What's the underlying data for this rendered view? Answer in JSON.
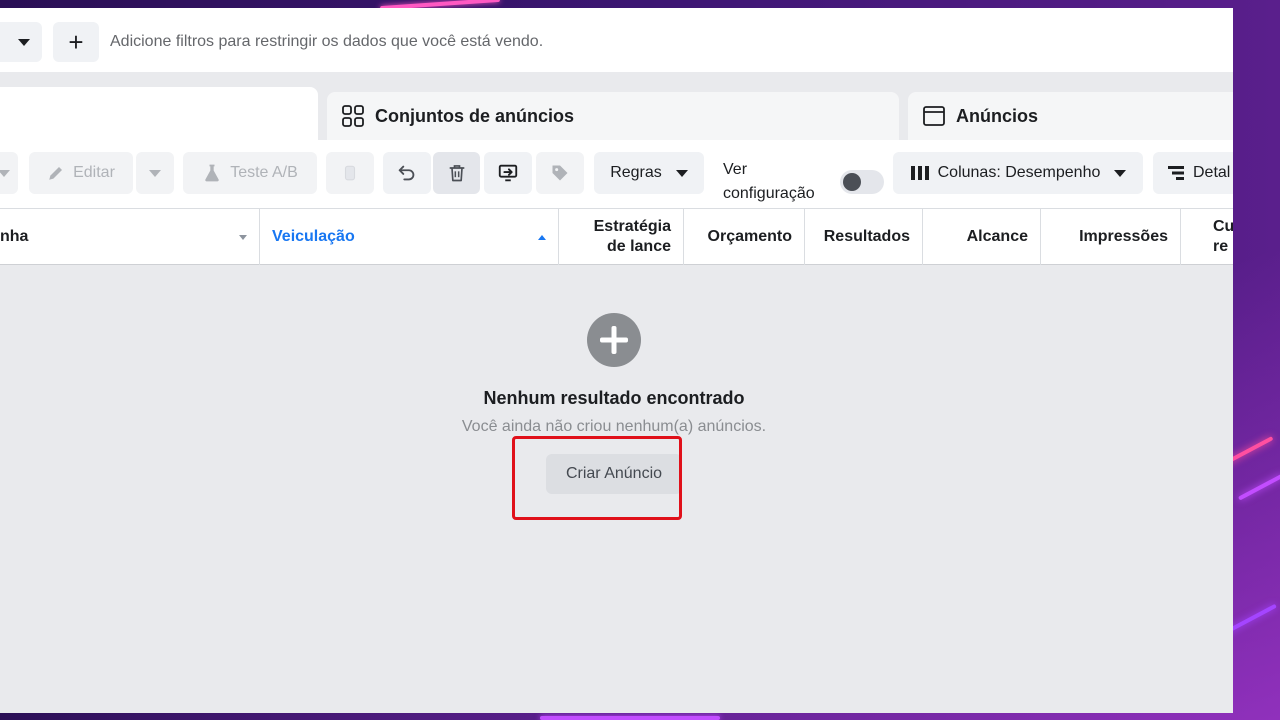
{
  "filter_bar": {
    "hint": "Adicione filtros para restringir os dados que você está vendo."
  },
  "tabs": {
    "adsets": "Conjuntos de anúncios",
    "ads": "Anúncios"
  },
  "toolbar": {
    "edit": "Editar",
    "ab_test": "Teste A/B",
    "rules": "Regras",
    "view_config_line1": "Ver",
    "view_config_line2": "configuração",
    "columns": "Colunas: Desempenho",
    "details": "Detal"
  },
  "table": {
    "columns": {
      "name": "nha",
      "delivery": "Veiculação",
      "bid_line1": "Estratégia",
      "bid_line2": "de lance",
      "budget": "Orçamento",
      "results": "Resultados",
      "reach": "Alcance",
      "impressions": "Impressões",
      "cost_line1": "Cu",
      "cost_line2": "re"
    }
  },
  "empty_state": {
    "title": "Nenhum resultado encontrado",
    "subtitle": "Você ainda não criou nenhum(a) anúncios.",
    "create_button": "Criar Anúncio"
  },
  "colors": {
    "accent": "#1877f2",
    "highlight": "#e0101a"
  }
}
